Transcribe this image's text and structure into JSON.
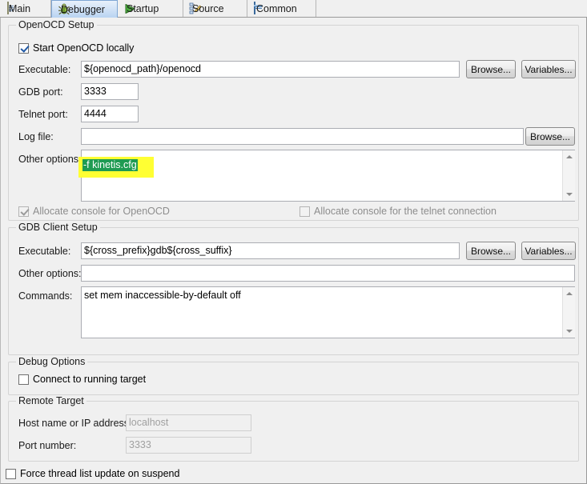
{
  "tabs": [
    {
      "label": "Main",
      "icon": "document-icon",
      "selected": false
    },
    {
      "label": "Debugger",
      "icon": "bug-icon",
      "selected": true
    },
    {
      "label": "Startup",
      "icon": "play-arrow-icon",
      "selected": false
    },
    {
      "label": "Source",
      "icon": "source-tree-icon",
      "selected": false
    },
    {
      "label": "Common",
      "icon": "list-table-icon",
      "selected": false
    }
  ],
  "openocd_setup": {
    "title": "OpenOCD Setup",
    "start_locally": {
      "label": "Start OpenOCD locally",
      "checked": true,
      "enabled": true
    },
    "executable": {
      "label": "Executable:",
      "value": "${openocd_path}/openocd"
    },
    "gdb_port": {
      "label": "GDB port:",
      "value": "3333"
    },
    "telnet_port": {
      "label": "Telnet port:",
      "value": "4444"
    },
    "log_file": {
      "label": "Log file:",
      "value": ""
    },
    "other_options": {
      "label": "Other options:",
      "value": "-f kinetis.cfg",
      "selection_text": "-f kinetis.cfg",
      "highlight_color": "#ffff33",
      "selection_bg": "#1f9b52",
      "selection_fg": "#ffffff"
    },
    "browse_executable": "Browse...",
    "variables_executable": "Variables...",
    "browse_log": "Browse...",
    "alloc_console_openocd": {
      "label": "Allocate console for OpenOCD",
      "checked": true,
      "enabled": false
    },
    "alloc_console_telnet": {
      "label": "Allocate console for the telnet connection",
      "checked": false,
      "enabled": false
    }
  },
  "gdb_client_setup": {
    "title": "GDB Client Setup",
    "executable": {
      "label": "Executable:",
      "value": "${cross_prefix}gdb${cross_suffix}"
    },
    "other_options": {
      "label": "Other options:",
      "value": ""
    },
    "commands": {
      "label": "Commands:",
      "value": "set mem inaccessible-by-default off"
    },
    "browse": "Browse...",
    "variables": "Variables..."
  },
  "debug_options": {
    "title": "Debug Options",
    "connect_running": {
      "label": "Connect to running target",
      "checked": false,
      "enabled": true
    }
  },
  "remote_target": {
    "title": "Remote Target",
    "host": {
      "label": "Host name or IP address:",
      "value": "localhost",
      "enabled": false
    },
    "port": {
      "label": "Port number:",
      "value": "3333",
      "enabled": false
    }
  },
  "force_thread_update": {
    "label": "Force thread list update on suspend",
    "checked": false,
    "enabled": true
  },
  "colors": {
    "dialog_bg": "#f0f0f0",
    "field_bg": "#ffffff",
    "group_border": "#d4d4d4",
    "tab_selected": "#b9d4f1",
    "highlight": "#ffff33",
    "selection": "#1f9b52"
  }
}
